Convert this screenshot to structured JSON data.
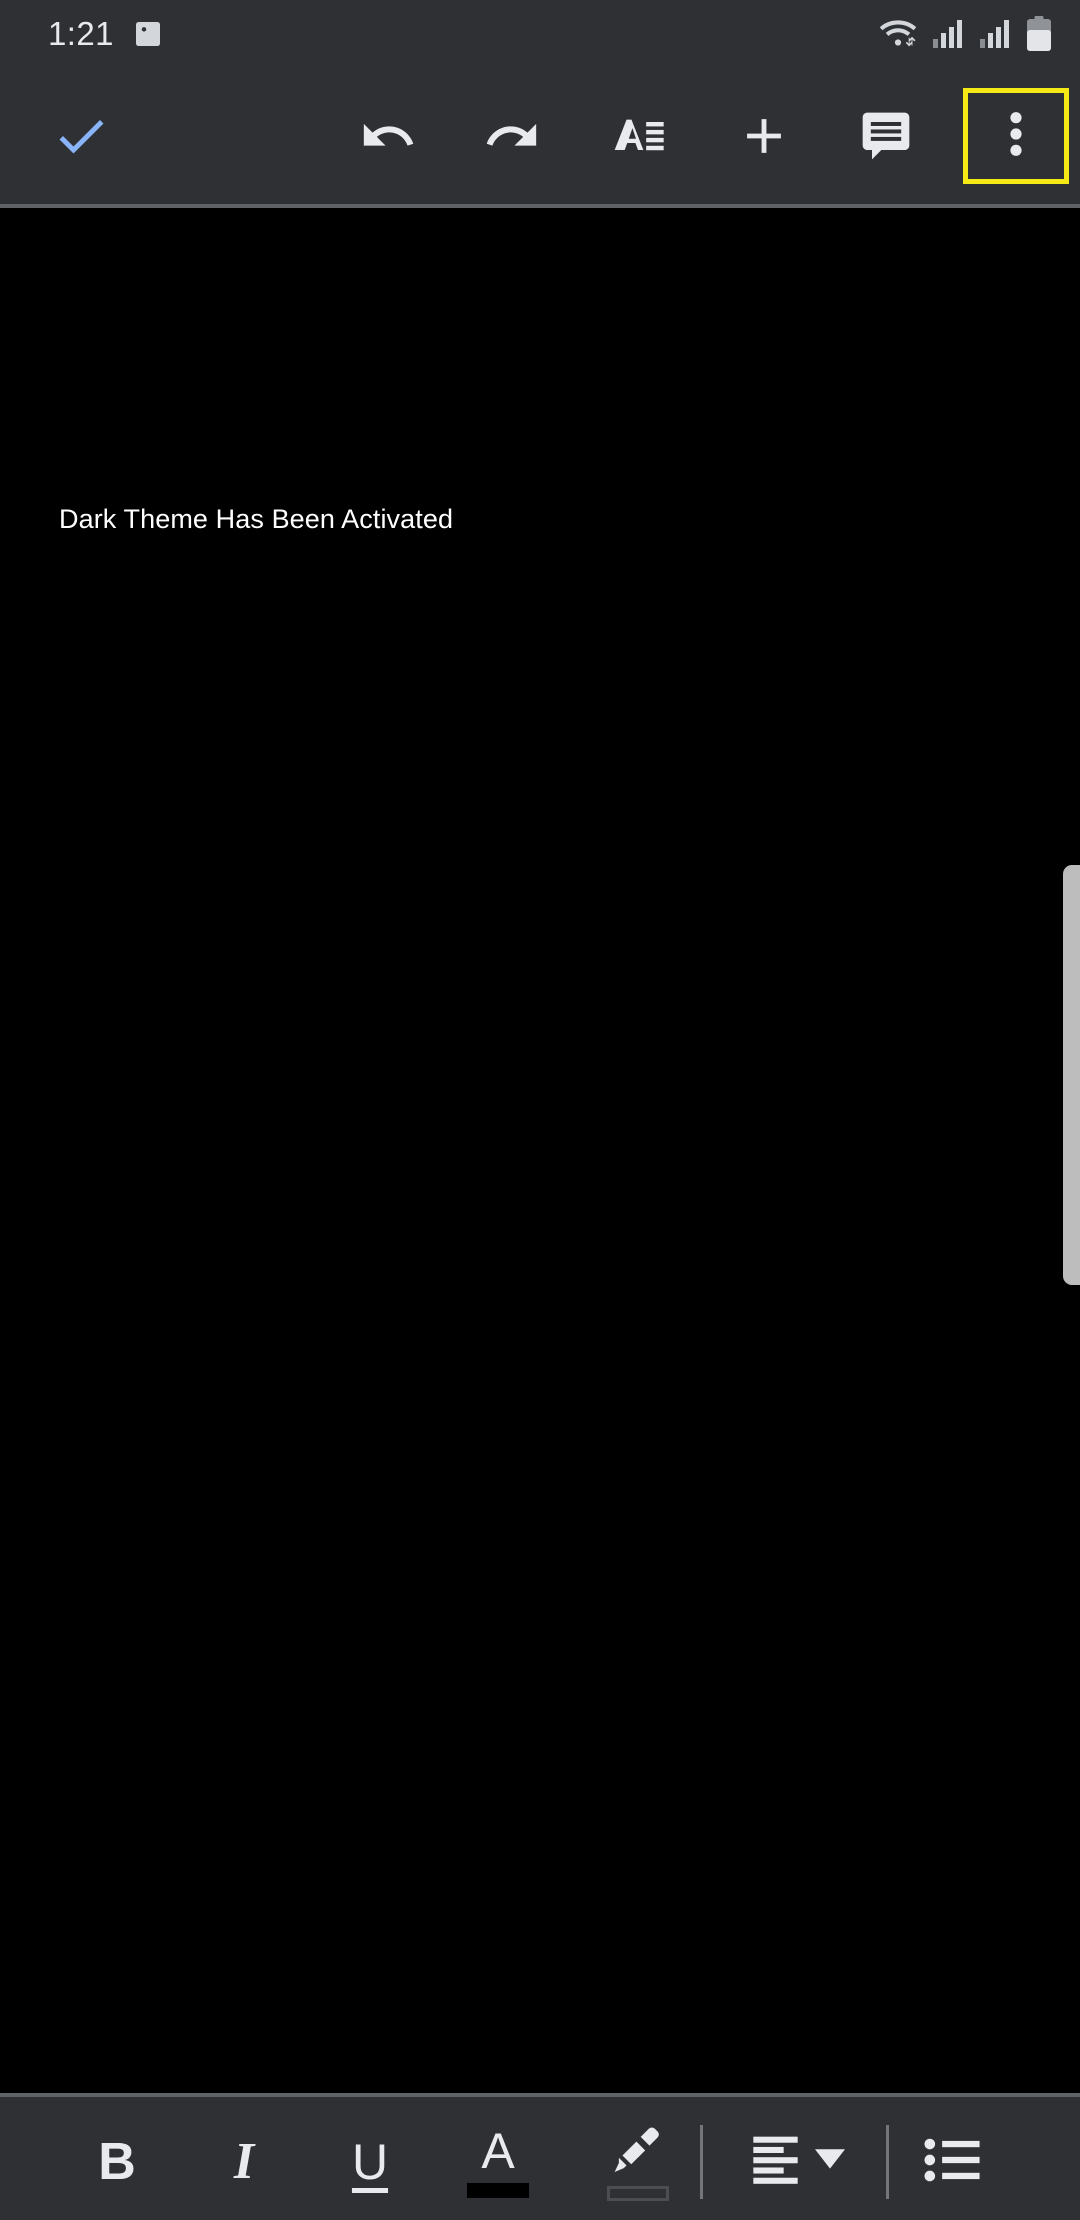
{
  "status_bar": {
    "clock": "1:21",
    "icons": [
      {
        "name": "photo-icon",
        "label": "Screenshot saved"
      },
      {
        "name": "wifi-icon",
        "label": "Wi-Fi connected with data transfer"
      },
      {
        "name": "signal-sim1-icon",
        "label": "SIM 1 signal strength"
      },
      {
        "name": "signal-sim2-icon",
        "label": "SIM 2 signal strength"
      },
      {
        "name": "battery-icon",
        "label": "Battery"
      }
    ]
  },
  "top_toolbar": {
    "buttons": [
      {
        "name": "done-button",
        "icon": "check-icon",
        "label": "Done"
      },
      {
        "name": "undo-button",
        "icon": "undo-icon",
        "label": "Undo"
      },
      {
        "name": "redo-button",
        "icon": "redo-icon",
        "label": "Redo"
      },
      {
        "name": "format-button",
        "icon": "format-text-icon",
        "label": "Format"
      },
      {
        "name": "insert-button",
        "icon": "plus-icon",
        "label": "Insert"
      },
      {
        "name": "comment-button",
        "icon": "comment-icon",
        "label": "Comment"
      },
      {
        "name": "more-options-button",
        "icon": "more-vertical-icon",
        "label": "More options"
      }
    ],
    "highlight_color": "#f5ea13",
    "background_color": "#2e3034"
  },
  "document": {
    "body_text": "Dark Theme Has Been Activated",
    "background_color": "#000000",
    "text_color": "#ffffff"
  },
  "scrollbar": {
    "name": "vertical-scrollbar",
    "color": "#bdbdbd"
  },
  "bottom_toolbar": {
    "background_color": "#2e3034",
    "buttons": [
      {
        "name": "bold-button",
        "glyph": "B",
        "label": "Bold"
      },
      {
        "name": "italic-button",
        "glyph": "I",
        "label": "Italic"
      },
      {
        "name": "underline-button",
        "glyph": "U",
        "label": "Underline"
      },
      {
        "name": "text-color-button",
        "glyph": "A",
        "label": "Text color",
        "swatch_color": "#000000"
      },
      {
        "name": "highlight-color-button",
        "glyph": "",
        "label": "Highlight color",
        "swatch_color": "none"
      },
      {
        "name": "align-button",
        "glyph": "",
        "label": "Alignment"
      },
      {
        "name": "bulleted-list-button",
        "glyph": "",
        "label": "Bulleted list"
      }
    ]
  }
}
